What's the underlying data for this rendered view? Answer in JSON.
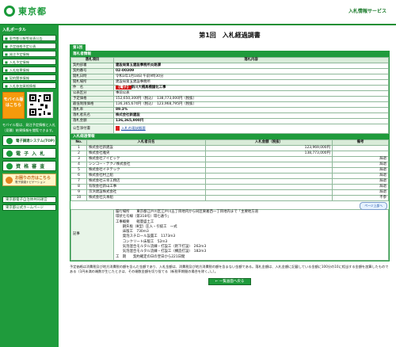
{
  "header": {
    "logo_text": "東京都",
    "service_title": "入札情報サービス"
  },
  "sidebar": {
    "heading": "入札ポータル",
    "menu": [
      "東京都公報等発表公告",
      "予定価格予定公表",
      "発注予定情報",
      "入札予定情報",
      "入札結果情報",
      "契約関係情報",
      "入札参加資格情報"
    ],
    "mobile_label": "モバイル版",
    "mobile_label_sub": "はこちら",
    "mobile_note": "モバイル版は、発注予定情報と入札（見積）結果情報を閲覧できます。",
    "big_buttons": [
      "電子調達システム(TOP)",
      "電 子 入 札",
      "資 格 審 査"
    ],
    "help_title": "お困りの方はこちら",
    "help_sub": "電子調達ナビゲーション",
    "related": [
      "東京都電子自治体共同運営",
      "東京都公式ホームページ"
    ]
  },
  "main": {
    "title": "第1回　入札経過調書",
    "round_tab": "第1回",
    "info_section_title": "落札者情報",
    "info_headers": [
      "落札項目",
      "落札内容"
    ],
    "info_rows": [
      {
        "label": "契約部署",
        "value": "建設局第五建設事務所炎路課"
      },
      {
        "label": "契約番号",
        "value": "02-00309"
      },
      {
        "label": "開札日時",
        "value": "令和3年1月18日 午前9時30分"
      },
      {
        "label": "開札場所",
        "value": "建設局第五建設事務所"
      },
      {
        "label": "件　名",
        "value": "新川大橋高橋舗化工事"
      },
      {
        "label": "公表区分",
        "value": "事前公表"
      },
      {
        "label": "予定価格",
        "value": "152,650,300円（税込）　138,773,000円（税抜）"
      },
      {
        "label": "最低制限価格",
        "value": "136,365,674円（税込）　123,968,795円（税抜）"
      },
      {
        "label": "落札率",
        "value": "89.3%"
      },
      {
        "label": "落札者氏名",
        "value": "株式会社新建設"
      },
      {
        "label": "落札金額",
        "value": "136,365,900円"
      }
    ],
    "title_tag": "【電子】",
    "pdf_label": "公告添付書",
    "pdf_link": "入札の現状概要",
    "bid_section_title": "入札経過情報",
    "bid_headers": [
      "No.",
      "入札者氏名",
      "入札金額（税抜）",
      "備考"
    ],
    "bids": [
      {
        "no": "1",
        "name": "株式会社新建設",
        "amount": "123,969,000円",
        "note": ""
      },
      {
        "no": "2",
        "name": "株式会社雅央",
        "amount": "138,773,000円",
        "note": ""
      },
      {
        "no": "3",
        "name": "株式会社アイビック",
        "amount": "",
        "note": "辞退"
      },
      {
        "no": "4",
        "name": "シンコー・テクノ株式会社",
        "amount": "",
        "note": "辞退"
      },
      {
        "no": "5",
        "name": "株式会社イチテック",
        "amount": "",
        "note": "辞退"
      },
      {
        "no": "6",
        "name": "株式会社村上組",
        "amount": "",
        "note": "辞退"
      },
      {
        "no": "7",
        "name": "株式会社三幸工務店",
        "amount": "",
        "note": "辞退"
      },
      {
        "no": "8",
        "name": "有限会社新山工事",
        "amount": "",
        "note": "辞退"
      },
      {
        "no": "9",
        "name": "京浜建設株式会社",
        "amount": "",
        "note": "辞退"
      },
      {
        "no": "10",
        "name": "株式会社久本組",
        "amount": "",
        "note": "不参"
      }
    ],
    "page_top": "ページ上部へ",
    "memo_label": "記事",
    "memo_lines": [
      "履行場所　　東京都江戸川区江戸川五丁目地内から同区東葛西一丁目地内まで「主要地方道",
      "環状七号線（第318号）環七通り」",
      "工事概要　　軽量盛土工",
      "　　鋼矢板（Ⅲ型）圧入・引抜工　一式",
      "　　床版工　730m3",
      "　　発泡スチロール設置工　1173m3",
      "　　コンクリート床版工　52m3",
      "　　気泡混合モルタル流練・打設工（剤下打設）　262m3",
      "　　気泡混合モルタル流練・打設工（構造打設）　182m3",
      "工　期　　契約確定の日の翌日から221日間"
    ],
    "footnote": "予定価格は消費税及び地方消費税の額を含んだ金額であり、入札金額は、消費税及び地方消費税の額を含まない金額である。落札金額は、入札金額に記載している金額に100分の10に相当する金額を加算したものである（1円未満の端数が生じたときは、その端数金額を切り捨てる（新税率期間の場合を除く。）。）。",
    "back_button": "← 一覧画面へ戻る"
  }
}
